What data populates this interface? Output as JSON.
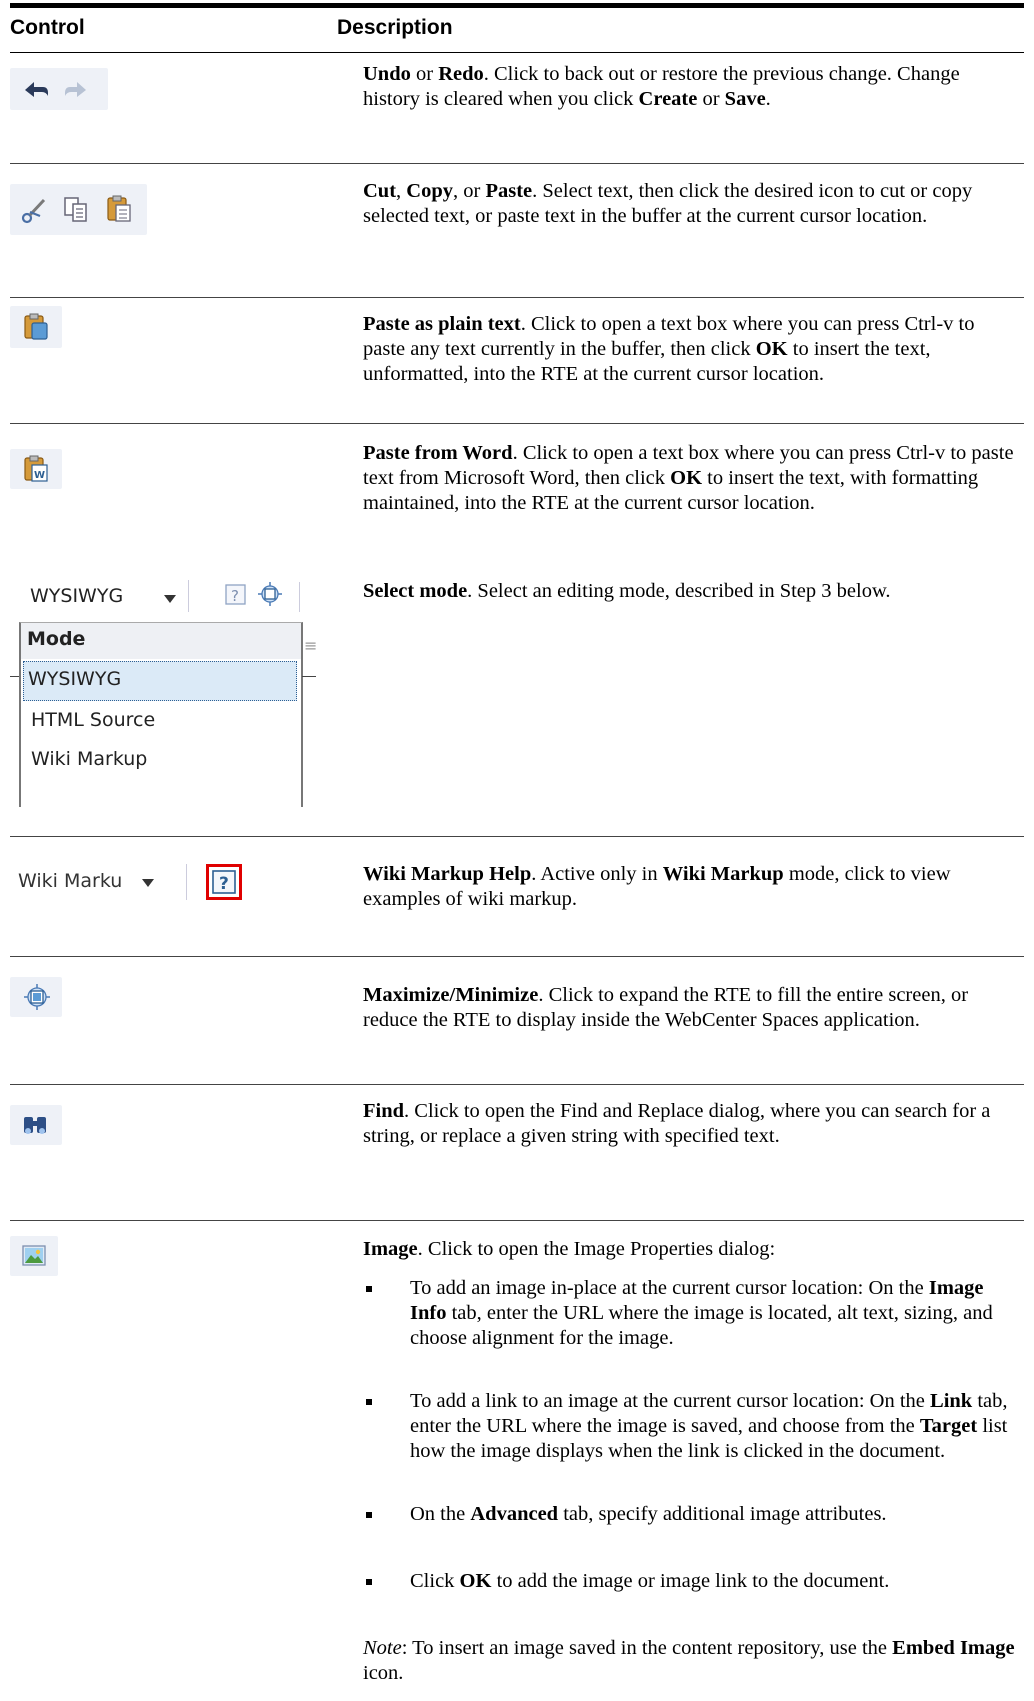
{
  "header": {
    "control": "Control",
    "description": "Description"
  },
  "rows": {
    "undo": {
      "title": "Undo",
      "or": " or ",
      "title2": "Redo",
      "text": ". Click to back out or restore the previous change. Change history is cleared when you click ",
      "create": "Create",
      "or2": " or ",
      "save": "Save",
      "end": "."
    },
    "cut": {
      "t1": "Cut",
      "s1": ", ",
      "t2": "Copy",
      "s2": ", or ",
      "t3": "Paste",
      "text": ". Select text, then click the desired icon to cut or copy selected text, or paste text in the buffer at the current cursor location."
    },
    "plain": {
      "title": "Paste as plain text",
      "text": ". Click to open a text box where you can press Ctrl-v to paste any text currently in the buffer, then click ",
      "ok": "OK",
      "text2": " to insert the text, unformatted, into the RTE at the current cursor location."
    },
    "word": {
      "title": "Paste from Word",
      "text": ". Click to open a text box where you can press Ctrl-v to paste text from Microsoft Word, then click ",
      "ok": "OK",
      "text2": " to insert the text, with formatting maintained, into the RTE at the current cursor location."
    },
    "mode": {
      "title": "Select mode",
      "text": ". Select an editing mode, described in Step 3 below.",
      "selected": "WYSIWYG",
      "menu_header": "Mode",
      "options": [
        "WYSIWYG",
        "HTML Source",
        "Wiki Markup"
      ]
    },
    "wiki": {
      "title": "Wiki Markup Help",
      "text": ". Active only in ",
      "mode": "Wiki Markup",
      "text2": " mode, click to view examples of wiki markup.",
      "dropdown_label": "Wiki Marku"
    },
    "maximize": {
      "title": "Maximize/Minimize",
      "text": ". Click to expand the RTE to fill the entire screen, or reduce the RTE to display inside the WebCenter Spaces application."
    },
    "find": {
      "title": "Find",
      "text": ". Click to open the Find and Replace dialog, where you can search for a string, or replace a given string with specified text."
    },
    "image": {
      "title": "Image",
      "text": ". Click to open the Image Properties dialog:",
      "b1_pre": "To add an image in-place at the current cursor location: On the ",
      "b1_bold": "Image Info",
      "b1_post": " tab, enter the URL where the image is located, alt text, sizing, and choose alignment for the image.",
      "b2_pre": "To add a link to an image at the current cursor location: On the ",
      "b2_bold": "Link",
      "b2_mid": " tab, enter the URL where the image is saved, and choose from the ",
      "b2_bold2": "Target",
      "b2_post": " list how the image displays when the link is clicked in the document.",
      "b3_pre": "On the ",
      "b3_bold": "Advanced",
      "b3_post": " tab, specify additional image attributes.",
      "b4_pre": "Click ",
      "b4_bold": "OK",
      "b4_post": " to add the image or image link to the document.",
      "note_label": "Note",
      "note_text": ": To insert an image saved in the content repository, use the ",
      "note_bold": "Embed Image",
      "note_end": " icon."
    }
  },
  "icons": [
    "undo-icon",
    "redo-icon",
    "cut-icon",
    "copy-icon",
    "paste-icon",
    "paste-plain-text-icon",
    "paste-from-word-icon",
    "help-icon",
    "maximize-icon",
    "find-icon",
    "image-icon"
  ],
  "colors": {
    "icon_bg": "#eef1f7",
    "help_highlight": "#e00000",
    "selected_option_bg": "#dbeaf7"
  }
}
